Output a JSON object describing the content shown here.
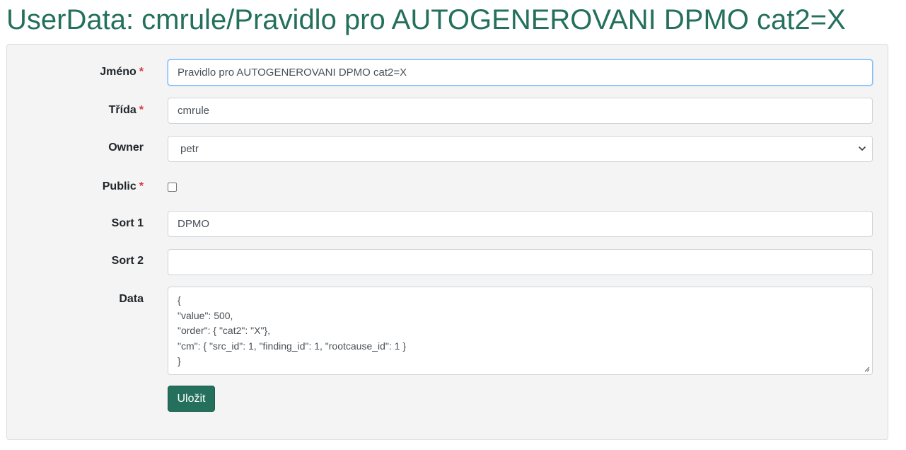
{
  "page": {
    "title": "UserData: cmrule/Pravidlo pro AUTOGENEROVANI DPMO cat2=X"
  },
  "form": {
    "required_marker": "*",
    "name": {
      "label": "Jméno",
      "value": "Pravidlo pro AUTOGENEROVANI DPMO cat2=X",
      "required": true
    },
    "class": {
      "label": "Třída",
      "value": "cmrule",
      "required": true
    },
    "owner": {
      "label": "Owner",
      "selected": "petr",
      "icon": "chevron-down-icon"
    },
    "public": {
      "label": "Public",
      "checked": false,
      "required": true
    },
    "sort1": {
      "label": "Sort 1",
      "value": "DPMO"
    },
    "sort2": {
      "label": "Sort 2",
      "value": ""
    },
    "data": {
      "label": "Data",
      "lines": [
        "{",
        "\"value\": 500,",
        "\"order\": { \"cat2\": \"X\"},",
        "\"cm\": { \"src_id\": 1, \"finding_id\": 1, \"rootcause_id\": 1 }",
        "}"
      ]
    },
    "save_label": "Uložit"
  },
  "colors": {
    "title": "#24705c",
    "primary_button": "#24705c",
    "required": "#dc3545",
    "panel_background": "#f4f4f4"
  }
}
